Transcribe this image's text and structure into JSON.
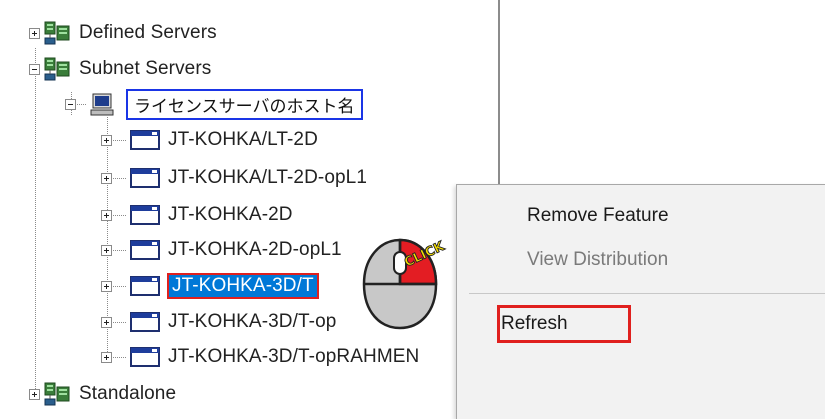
{
  "tree": {
    "defined_servers": "Defined Servers",
    "subnet_servers": "Subnet Servers",
    "host": "ライセンスサーバのホスト名",
    "features": [
      "JT-KOHKA/LT-2D",
      "JT-KOHKA/LT-2D-opL1",
      "JT-KOHKA-2D",
      "JT-KOHKA-2D-opL1",
      "JT-KOHKA-3D/T",
      "JT-KOHKA-3D/T-op",
      "JT-KOHKA-3D/T-opRAHMEN"
    ],
    "standalone": "Standalone"
  },
  "context_menu": {
    "items": [
      "Remove Feature",
      "View Distribution",
      "Refresh"
    ],
    "disabled_index": 1,
    "highlighted_index": 2
  },
  "click_badge": "CLICK",
  "colors": {
    "selection": "#0078d7",
    "highlight_outline": "#e0201e",
    "host_outline": "#1a35e6",
    "disabled_text": "#7a7a7a"
  }
}
